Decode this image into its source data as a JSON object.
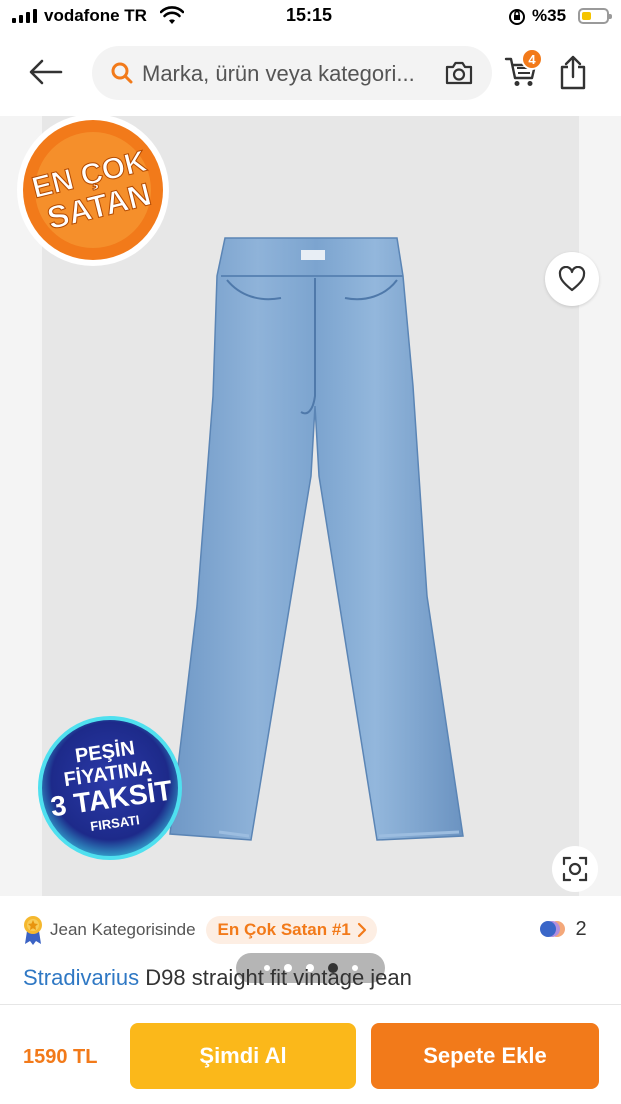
{
  "status_bar": {
    "carrier": "vodafone TR",
    "time": "15:15",
    "battery": "%35"
  },
  "header": {
    "search_placeholder": "Marka, ürün veya kategori...",
    "cart_count": "4"
  },
  "gallery": {
    "bestseller_badge_line1": "EN ÇOK",
    "bestseller_badge_line2": "SATAN",
    "installment_line1": "PEŞİN",
    "installment_line2": "FİYATINA",
    "installment_line3": "3 TAKSİT",
    "installment_line4": "FIRSATI",
    "variant_count": "2",
    "image_count": 5,
    "active_image_index": 4
  },
  "product": {
    "category_text": "Jean Kategorisinde",
    "rank_label": "En Çok Satan #1",
    "brand": "Stradivarius",
    "name": "D98 straight fit vintage jean"
  },
  "bottom_bar": {
    "price": "1590 TL",
    "buy_now_label": "Şimdi Al",
    "add_to_cart_label": "Sepete Ekle"
  },
  "colors": {
    "accent": "#f27a1a",
    "buy_now": "#fbb81a",
    "brand_link": "#2f78c4"
  }
}
